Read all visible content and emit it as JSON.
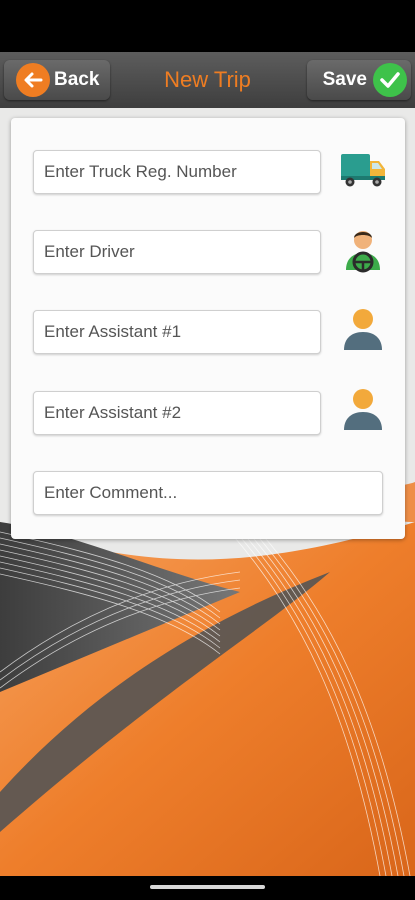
{
  "header": {
    "title": "New Trip",
    "back_label": "Back",
    "save_label": "Save"
  },
  "form": {
    "truck_placeholder": "Enter Truck Reg. Number",
    "driver_placeholder": "Enter Driver",
    "assistant1_placeholder": "Enter Assistant #1",
    "assistant2_placeholder": "Enter Assistant #2",
    "comment_placeholder": "Enter Comment..."
  },
  "icons": [
    "back-arrow-icon",
    "checkmark-icon",
    "truck-icon",
    "driver-icon",
    "person-icon"
  ],
  "colors": {
    "accent": "#ef7d22",
    "save_green": "#3ec24a",
    "header": "#4a4a4a"
  }
}
